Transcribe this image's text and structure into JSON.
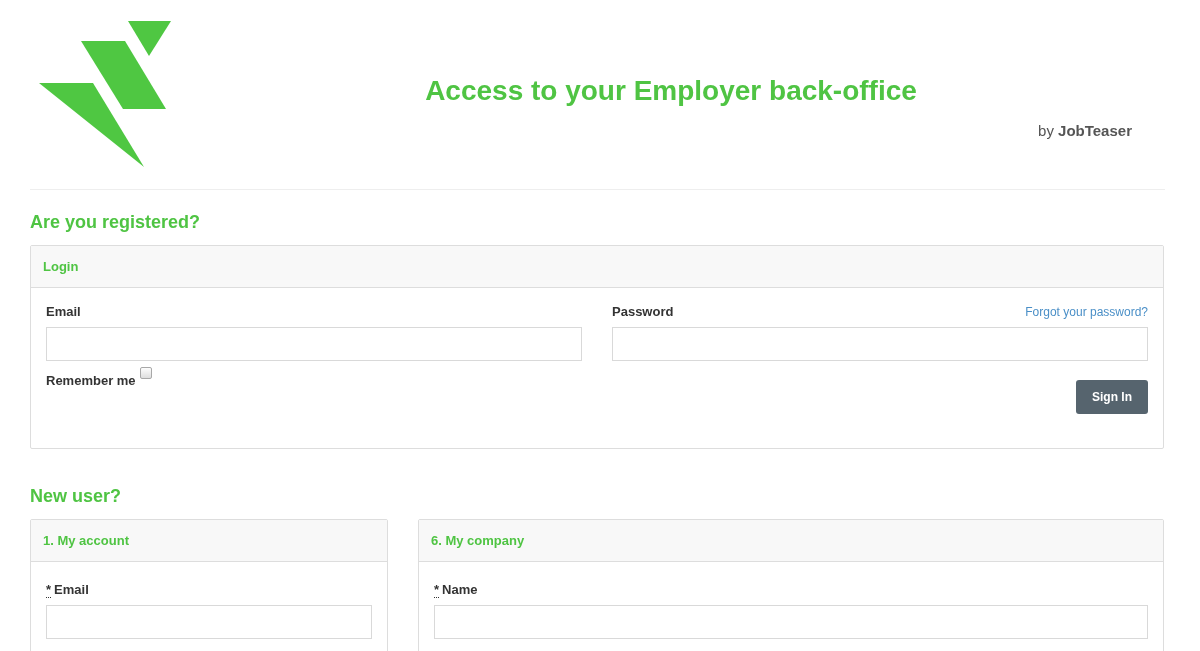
{
  "header": {
    "title": "Access to your Employer back-office",
    "byline": "by **JobTeaser**"
  },
  "login_section": {
    "heading": "Are you registered?",
    "panel_title": "Login",
    "email": {
      "label": "Email"
    },
    "password": {
      "label": "Password",
      "link": "Forgot your password?"
    },
    "remember_me": {
      "label": "Remember me",
      "checked": false
    },
    "submit": "Sign In"
  },
  "new_user_section": {
    "heading": "New user?",
    "panels": [
      {
        "title": "1. My account",
        "fields": [
          {
            "required_mark": "*",
            "label": "Email"
          }
        ]
      },
      {
        "title": "6. My company",
        "fields": [
          {
            "required_mark": "*",
            "label": "Name"
          }
        ]
      }
    ]
  }
}
